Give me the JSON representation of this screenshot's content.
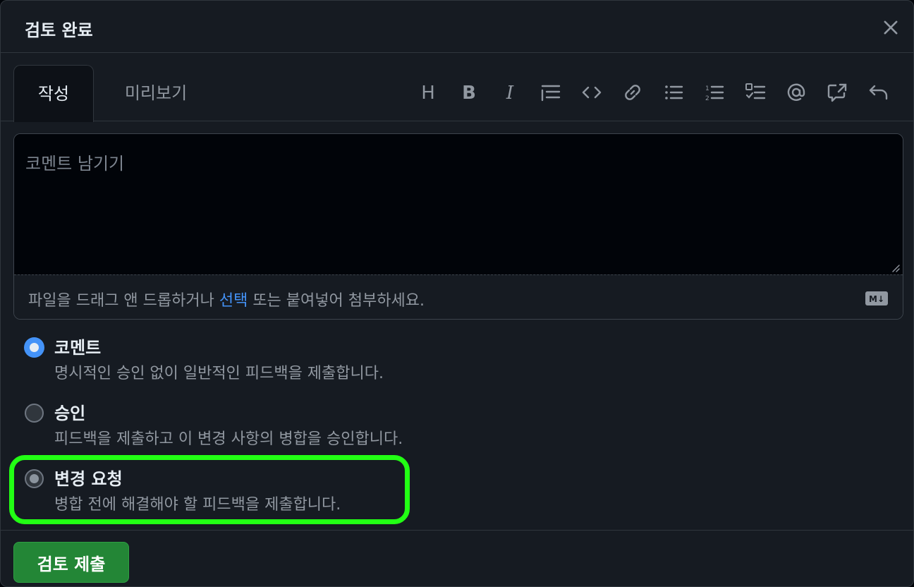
{
  "dialog": {
    "title": "검토 완료"
  },
  "tabs": [
    {
      "label": "작성",
      "active": true
    },
    {
      "label": "미리보기",
      "active": false
    }
  ],
  "toolbar": {
    "icons": [
      "heading-icon",
      "bold-icon",
      "italic-icon",
      "quote-icon",
      "code-icon",
      "link-icon",
      "unordered-list-icon",
      "ordered-list-icon",
      "task-list-icon",
      "mention-icon",
      "cross-reference-icon",
      "undo-icon"
    ],
    "heading_glyph": "H",
    "bold_glyph": "B",
    "italic_glyph": "I"
  },
  "editor": {
    "placeholder": "코멘트 남기기",
    "value": "",
    "attach_prefix": "파일을 드래그 앤 드롭하거나 ",
    "attach_link": "선택",
    "attach_suffix": " 또는 붙여넣어 첨부하세요.",
    "markdown_badge": "M↓"
  },
  "review_options": [
    {
      "label": "코멘트",
      "description": "명시적인 승인 없이 일반적인 피드백을 제출합니다.",
      "checked": true
    },
    {
      "label": "승인",
      "description": "피드백을 제출하고 이 변경 사항의 병합을 승인합니다.",
      "checked": false
    },
    {
      "label": "변경 요청",
      "description": "병합 전에 해결해야 할 피드백을 제출합니다.",
      "checked": false
    }
  ],
  "submit": {
    "label": "검토 제출"
  },
  "colors": {
    "accent": "#4493f8",
    "submit": "#238636",
    "highlight": "#22ff14"
  }
}
